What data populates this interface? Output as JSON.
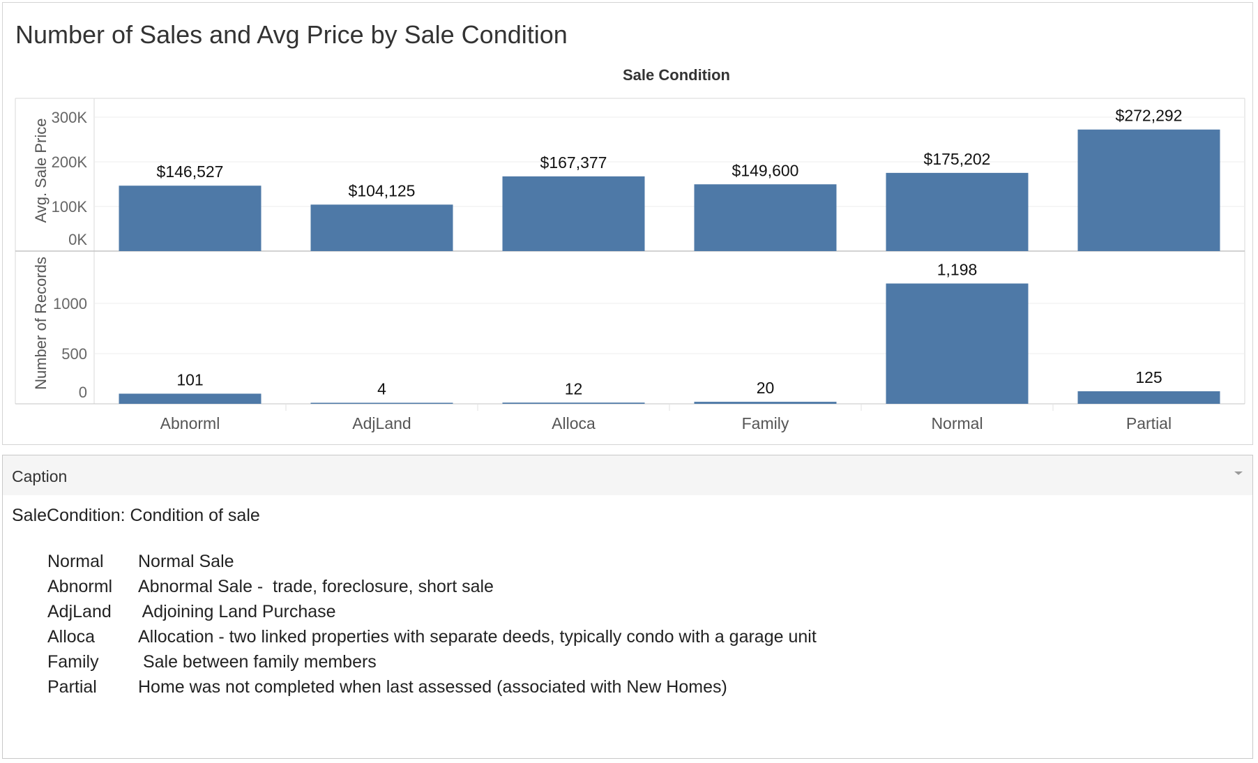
{
  "chart": {
    "title": "Number of Sales and Avg Price by Sale Condition",
    "column_header": "Sale Condition"
  },
  "chart_data": {
    "type": "bar",
    "column_dimension": "Sale Condition",
    "categories": [
      "Abnorml",
      "AdjLand",
      "Alloca",
      "Family",
      "Normal",
      "Partial"
    ],
    "panes": [
      {
        "measure": "Avg. Sale Price",
        "ylabel": "Avg. Sale Price",
        "values": [
          146527,
          104125,
          167377,
          149600,
          175202,
          272292
        ],
        "data_labels": [
          "$146,527",
          "$104,125",
          "$167,377",
          "$149,600",
          "$175,202",
          "$272,292"
        ],
        "ticks": [
          0,
          100000,
          200000,
          300000
        ],
        "tick_labels": [
          "0K",
          "100K",
          "200K",
          "300K"
        ],
        "ylim": [
          0,
          320000
        ]
      },
      {
        "measure": "Number of Records",
        "ylabel": "Number of Records",
        "values": [
          101,
          4,
          12,
          20,
          1198,
          125
        ],
        "data_labels": [
          "101",
          "4",
          "12",
          "20",
          "1,198",
          "125"
        ],
        "ticks": [
          0,
          500,
          1000
        ],
        "tick_labels": [
          "0",
          "500",
          "1000"
        ],
        "ylim": [
          0,
          1400
        ]
      }
    ],
    "grid": true,
    "legend": "none",
    "bar_color": "#4e79a7"
  },
  "caption": {
    "title": "Caption",
    "intro": "SaleCondition: Condition of sale",
    "definitions": [
      {
        "code": "Normal",
        "description": "Normal Sale"
      },
      {
        "code": "Abnorml",
        "description": "Abnormal Sale -  trade, foreclosure, short sale"
      },
      {
        "code": "AdjLand",
        "description": " Adjoining Land Purchase"
      },
      {
        "code": "Alloca",
        "description": "Allocation - two linked properties with separate deeds, typically condo with a garage unit"
      },
      {
        "code": "Family",
        "description": " Sale between family members"
      },
      {
        "code": "Partial",
        "description": "Home was not completed when last assessed (associated with New Homes)"
      }
    ]
  },
  "icons": {
    "caption_menu": "chevron-down-icon"
  }
}
